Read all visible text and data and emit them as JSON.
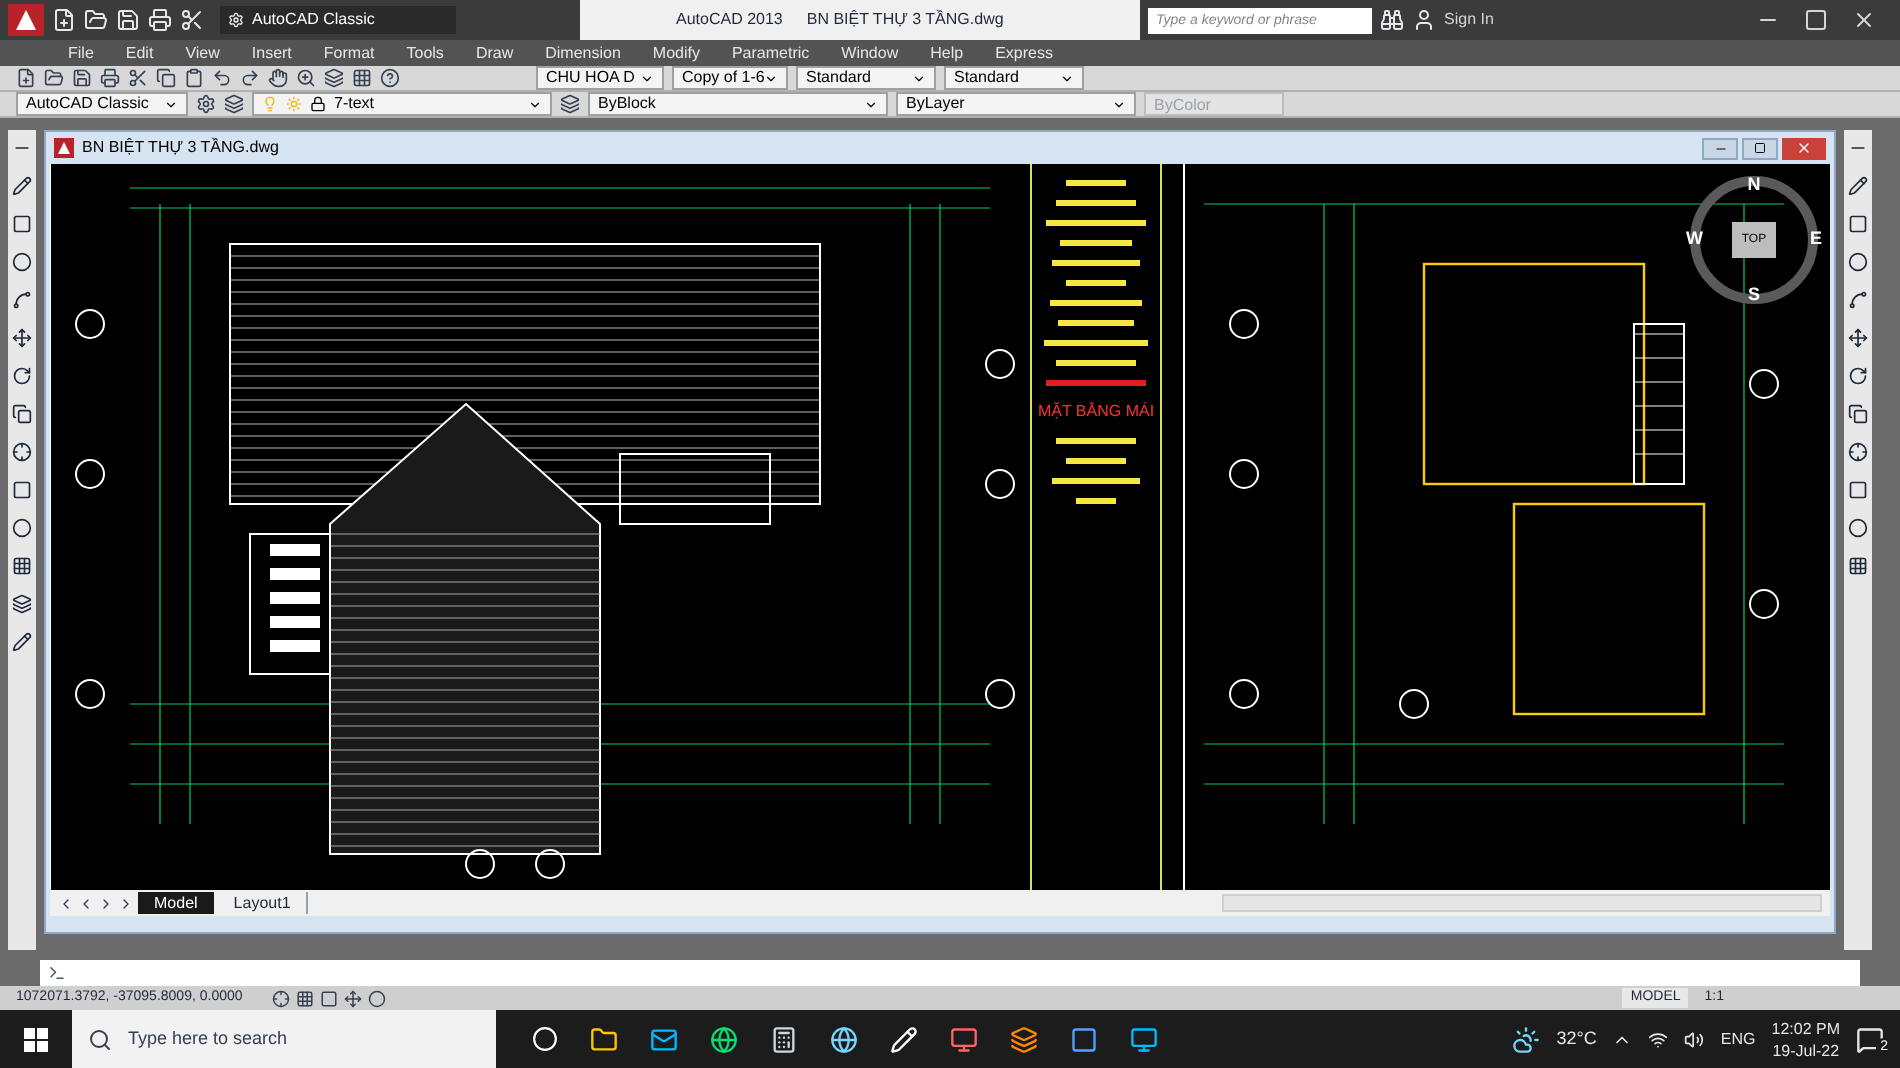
{
  "app": {
    "title": "AutoCAD 2013",
    "file": "BN BIỆT THỰ 3 TẦNG.dwg",
    "workspace": "AutoCAD Classic",
    "search_placeholder": "Type a keyword or phrase",
    "sign_in": "Sign In"
  },
  "menu": [
    "File",
    "Edit",
    "View",
    "Insert",
    "Format",
    "Tools",
    "Draw",
    "Dimension",
    "Modify",
    "Parametric",
    "Window",
    "Help",
    "Express"
  ],
  "toolbar_1": {
    "text_style": "CHU HOA D",
    "dim_style": "Copy of 1-6",
    "table_style": "Standard",
    "multileader_style": "Standard"
  },
  "toolbar_2": {
    "workspace": "AutoCAD Classic",
    "layer": "7-text",
    "color_control": "ByBlock",
    "linetype": "ByLayer",
    "plot_style": "ByColor"
  },
  "drawing_window": {
    "title": "BN BIỆT THỰ 3 TẦNG.dwg",
    "viewcube": {
      "north": "N",
      "south": "S",
      "west": "W",
      "east": "E",
      "top": "TOP"
    },
    "sheet_title": "MẶT BẰNG MÁI",
    "tabs": [
      {
        "label": "Model",
        "selected": true
      },
      {
        "label": "Layout1",
        "selected": false
      }
    ]
  },
  "status_bar": {
    "coordinates": "1072071.3792, -37095.8009, 0.0000",
    "space": "MODEL",
    "scale": "1:1"
  },
  "taskbar": {
    "search_placeholder": "Type here to search",
    "temperature": "32°C",
    "language": "ENG",
    "time": "12:02 PM",
    "date": "19-Jul-22",
    "notifications": "2"
  }
}
